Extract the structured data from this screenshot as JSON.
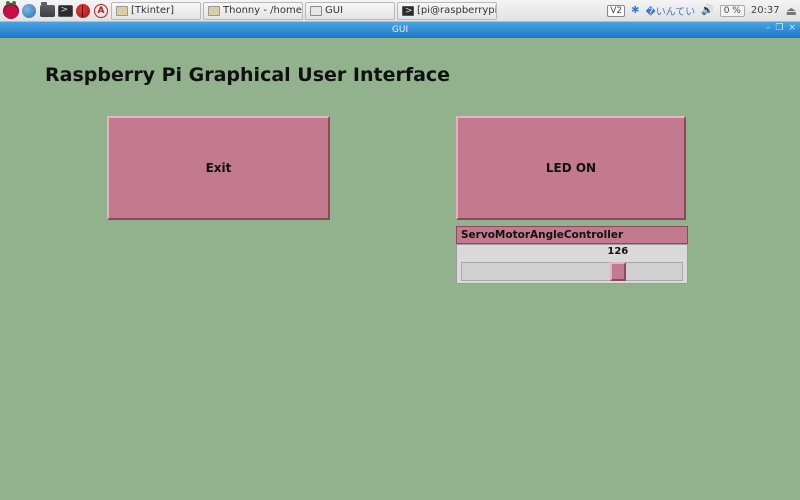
{
  "taskbar": {
    "items": [
      {
        "label": "[Tkinter]"
      },
      {
        "label": "Thonny  -  /home/pi/..."
      },
      {
        "label": "GUI"
      },
      {
        "label": "[pi@raspberrypi: ~]"
      }
    ],
    "vnc": "V2",
    "cpu": "0 %",
    "clock": "20:37"
  },
  "window": {
    "title": "GUI",
    "btn_min": "–",
    "btn_max": "❐",
    "btn_close": "×"
  },
  "app": {
    "heading": "Raspberry Pi Graphical User Interface",
    "exit_label": "Exit",
    "led_label": "LED ON",
    "slider": {
      "label": "ServoMotorAngleController",
      "value": "126",
      "min": 0,
      "max": 180,
      "thumb_percent": 70
    }
  },
  "colors": {
    "app_bg": "#92b28d",
    "widget_pink": "#c47a8e",
    "titlebar_blue": "#1e78c8"
  }
}
